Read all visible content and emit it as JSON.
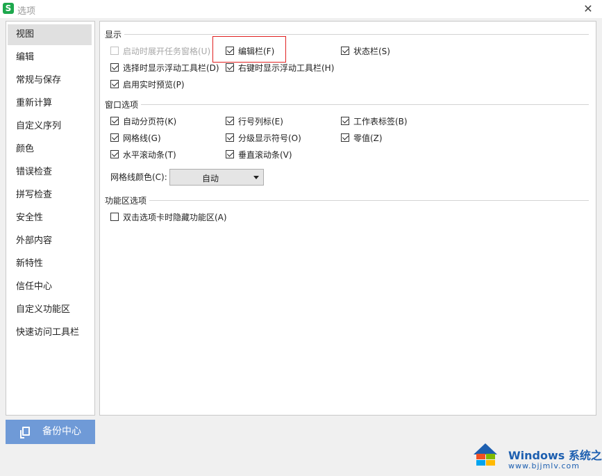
{
  "window": {
    "title": "选项",
    "app_icon_letter": "S"
  },
  "sidebar": {
    "items": [
      {
        "label": "视图",
        "active": true
      },
      {
        "label": "编辑"
      },
      {
        "label": "常规与保存"
      },
      {
        "label": "重新计算"
      },
      {
        "label": "自定义序列"
      },
      {
        "label": "颜色"
      },
      {
        "label": "错误检查"
      },
      {
        "label": "拼写检查"
      },
      {
        "label": "安全性"
      },
      {
        "label": "外部内容"
      },
      {
        "label": "新特性"
      },
      {
        "label": "信任中心"
      },
      {
        "label": "自定义功能区"
      },
      {
        "label": "快速访问工具栏"
      }
    ],
    "backup_label": "备份中心"
  },
  "display": {
    "title": "显示",
    "show_taskpane": {
      "label": "启动时展开任务窗格(U)",
      "checked": false,
      "disabled": true
    },
    "formula_bar": {
      "label": "编辑栏(F)",
      "checked": true
    },
    "status_bar": {
      "label": "状态栏(S)",
      "checked": true
    },
    "float_toolbar_select": {
      "label": "选择时显示浮动工具栏(D)",
      "checked": true
    },
    "float_toolbar_rightclick": {
      "label": "右键时显示浮动工具栏(H)",
      "checked": true
    },
    "live_preview": {
      "label": "启用实时预览(P)",
      "checked": true
    }
  },
  "window_options": {
    "title": "窗口选项",
    "page_breaks": {
      "label": "自动分页符(K)",
      "checked": true
    },
    "row_col_headers": {
      "label": "行号列标(E)",
      "checked": true
    },
    "sheet_tabs": {
      "label": "工作表标签(B)",
      "checked": true
    },
    "gridlines": {
      "label": "网格线(G)",
      "checked": true
    },
    "outline_symbols": {
      "label": "分级显示符号(O)",
      "checked": true
    },
    "zero_values": {
      "label": "零值(Z)",
      "checked": true
    },
    "h_scrollbar": {
      "label": "水平滚动条(T)",
      "checked": true
    },
    "v_scrollbar": {
      "label": "垂直滚动条(V)",
      "checked": true
    },
    "gridline_color_label": "网格线颜色(C):",
    "gridline_color_value": "自动"
  },
  "ribbon_options": {
    "title": "功能区选项",
    "hide_ribbon": {
      "label": "双击选项卡时隐藏功能区(A)",
      "checked": false
    }
  },
  "watermark": {
    "title": "Windows 系统之家",
    "url": "www.bjjmlv.com",
    "icon": "windows-logo-icon"
  },
  "colors": {
    "highlight_border": "#e02020",
    "backup_button": "#6f9ad7",
    "app_icon": "#1ea84d"
  }
}
